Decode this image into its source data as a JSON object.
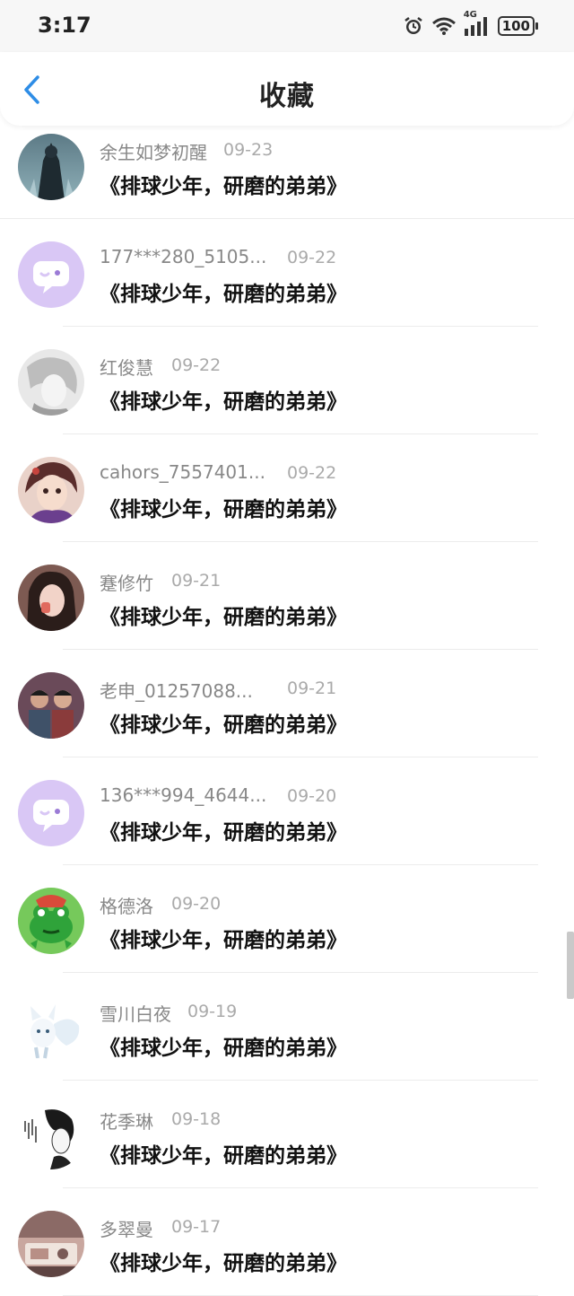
{
  "status_bar": {
    "time": "3:17",
    "network": "4G",
    "battery": "100",
    "icons": [
      "alarm-icon",
      "wifi-icon",
      "signal-icon",
      "battery-icon"
    ]
  },
  "header": {
    "title": "收藏",
    "back_icon": "chevron-left-icon"
  },
  "colors": {
    "accent": "#2e8de6",
    "default_avatar_bg": "#d9c7f5",
    "default_avatar_icon": "#ffffff"
  },
  "items": [
    {
      "name": "余生如梦初醒",
      "date": "09-23",
      "title": "《排球少年，研磨的弟弟》",
      "avatar": "dark-figure-avatar"
    },
    {
      "name": "177***280_5105...",
      "date": "09-22",
      "title": "《排球少年，研磨的弟弟》",
      "avatar": "default-chat-avatar"
    },
    {
      "name": "红俊慧",
      "date": "09-22",
      "title": "《排球少年，研磨的弟弟》",
      "avatar": "sketch-anime-avatar"
    },
    {
      "name": "cahors_7557401...",
      "date": "09-22",
      "title": "《排球少年，研磨的弟弟》",
      "avatar": "anime-girl-avatar"
    },
    {
      "name": "蹇修竹",
      "date": "09-21",
      "title": "《排球少年，研磨的弟弟》",
      "avatar": "photo-girl-avatar"
    },
    {
      "name": "老申_01257088...",
      "date": "09-21",
      "title": "《排球少年，研磨的弟弟》",
      "avatar": "photo-kids-avatar"
    },
    {
      "name": "136***994_4644...",
      "date": "09-20",
      "title": "《排球少年，研磨的弟弟》",
      "avatar": "default-chat-avatar"
    },
    {
      "name": "格德洛",
      "date": "09-20",
      "title": "《排球少年，研磨的弟弟》",
      "avatar": "frog-avatar"
    },
    {
      "name": "雪川白夜",
      "date": "09-19",
      "title": "《排球少年，研磨的弟弟》",
      "avatar": "white-fox-avatar"
    },
    {
      "name": "花季琳",
      "date": "09-18",
      "title": "《排球少年，研磨的弟弟》",
      "avatar": "ink-sketch-avatar"
    },
    {
      "name": "多翠曼",
      "date": "09-17",
      "title": "《排球少年，研磨的弟弟》",
      "avatar": "photo-room-avatar"
    }
  ]
}
